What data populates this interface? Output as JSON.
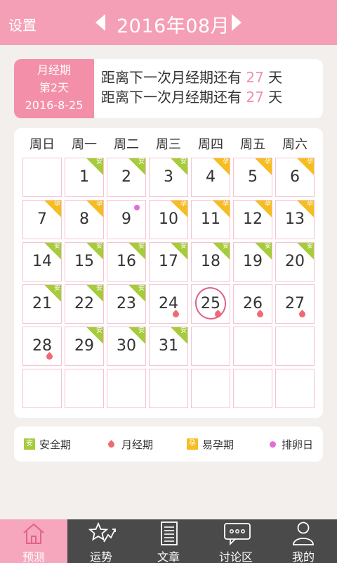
{
  "header": {
    "settings_label": "设置",
    "month_title": "2016年08月"
  },
  "info": {
    "period_label": "月经期",
    "period_day": "第2天",
    "period_date": "2016-8-25",
    "line_prefix": "距离下一次月经期还有",
    "line_days": "27",
    "line_unit": "天",
    "line2_prefix": "距离下一次月经期还有",
    "line2_days": "27",
    "line2_unit": "天"
  },
  "calendar": {
    "weekdays": [
      "周日",
      "周一",
      "周二",
      "周三",
      "周四",
      "周五",
      "周六"
    ],
    "safe_tag": "安",
    "preg_tag": "孕",
    "selected_day": "25",
    "days": [
      {
        "n": "1",
        "type": "safe"
      },
      {
        "n": "2",
        "type": "safe"
      },
      {
        "n": "3",
        "type": "safe"
      },
      {
        "n": "4",
        "type": "preg"
      },
      {
        "n": "5",
        "type": "preg"
      },
      {
        "n": "6",
        "type": "preg"
      },
      {
        "n": "7",
        "type": "preg"
      },
      {
        "n": "8",
        "type": "preg"
      },
      {
        "n": "9",
        "type": "ovulation"
      },
      {
        "n": "10",
        "type": "preg"
      },
      {
        "n": "11",
        "type": "preg"
      },
      {
        "n": "12",
        "type": "preg"
      },
      {
        "n": "13",
        "type": "preg"
      },
      {
        "n": "14",
        "type": "safe"
      },
      {
        "n": "15",
        "type": "safe"
      },
      {
        "n": "16",
        "type": "safe"
      },
      {
        "n": "17",
        "type": "safe"
      },
      {
        "n": "18",
        "type": "safe"
      },
      {
        "n": "19",
        "type": "safe"
      },
      {
        "n": "20",
        "type": "safe"
      },
      {
        "n": "21",
        "type": "safe"
      },
      {
        "n": "22",
        "type": "safe"
      },
      {
        "n": "23",
        "type": "safe"
      },
      {
        "n": "24",
        "type": "period"
      },
      {
        "n": "25",
        "type": "period"
      },
      {
        "n": "26",
        "type": "period"
      },
      {
        "n": "27",
        "type": "period"
      },
      {
        "n": "28",
        "type": "period"
      },
      {
        "n": "29",
        "type": "safe"
      },
      {
        "n": "30",
        "type": "safe"
      },
      {
        "n": "31",
        "type": "safe"
      }
    ],
    "first_weekday_offset": 1
  },
  "legend": {
    "safe_label": "安全期",
    "period_label": "月经期",
    "preg_label": "易孕期",
    "ovulation_label": "排卵日"
  },
  "nav": {
    "items": [
      {
        "label": "预测",
        "icon": "house-icon"
      },
      {
        "label": "运势",
        "icon": "star-trend-icon"
      },
      {
        "label": "文章",
        "icon": "document-icon"
      },
      {
        "label": "讨论区",
        "icon": "chat-bubble-icon"
      },
      {
        "label": "我的",
        "icon": "person-icon"
      }
    ],
    "active_index": 0
  },
  "colors": {
    "header": "#f59fb7",
    "period_block": "#f38fa8",
    "safe": "#a6cc3c",
    "fertile": "#f5bd1f",
    "period_drop": "#f06a72",
    "ovulation": "#e36cd5",
    "nav_bg": "#4a4a4a"
  }
}
